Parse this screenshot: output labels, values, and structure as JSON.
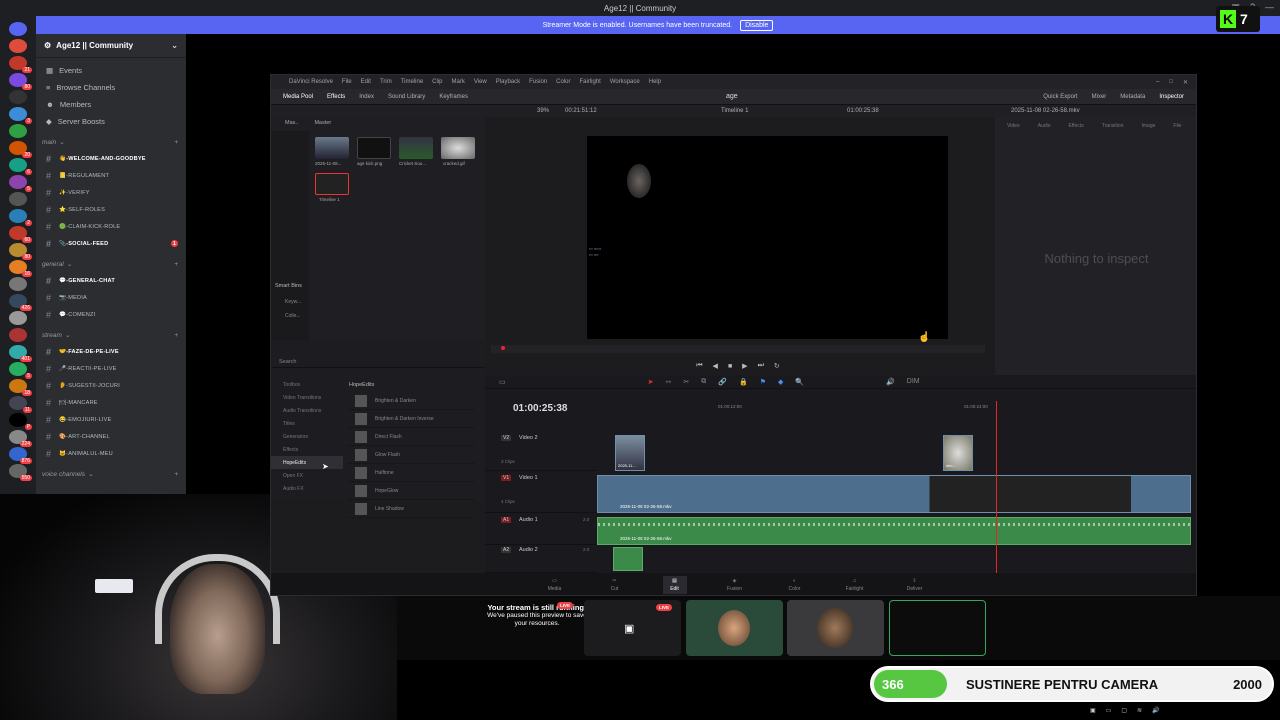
{
  "window": {
    "title": "Age12 || Community"
  },
  "banner": {
    "text": "Streamer Mode is enabled. Usernames have been truncated.",
    "button": "Disable"
  },
  "kick": {
    "count": "7"
  },
  "servers": [
    {
      "badge": ""
    },
    {
      "badge": "21"
    },
    {
      "badge": "80"
    },
    {
      "badge": ""
    },
    {
      "badge": "3"
    },
    {
      "badge": ""
    },
    {
      "badge": "20"
    },
    {
      "badge": "6"
    },
    {
      "badge": "5"
    },
    {
      "badge": ""
    },
    {
      "badge": "2"
    },
    {
      "badge": "60"
    },
    {
      "badge": "80"
    },
    {
      "badge": "16"
    },
    {
      "badge": ""
    },
    {
      "badge": "426"
    },
    {
      "badge": ""
    },
    {
      "badge": ""
    },
    {
      "badge": "401"
    },
    {
      "badge": "5"
    },
    {
      "badge": "18"
    },
    {
      "badge": "11"
    },
    {
      "badge": "P"
    },
    {
      "badge": "224"
    },
    {
      "badge": "876"
    },
    {
      "badge": "550"
    }
  ],
  "guild": {
    "name": "Age12 || Community"
  },
  "nav": {
    "events": "Events",
    "browse": "Browse Channels",
    "members": "Members",
    "boosts": "Server Boosts"
  },
  "categories": {
    "main": "main",
    "general": "general",
    "stream": "stream",
    "voice": "voice channels"
  },
  "channels_main": [
    {
      "label": "👋-welcome-and-goodbye"
    },
    {
      "label": "📒-regulament"
    },
    {
      "label": "✨-verify"
    },
    {
      "label": "⭐-self-roles"
    },
    {
      "label": "🟢-claim-kick-role"
    },
    {
      "label": "📎-social-feed",
      "badge": "1"
    }
  ],
  "channels_general": [
    {
      "label": "💬-general-chat"
    },
    {
      "label": "📷-media"
    },
    {
      "label": "💬-comenzi"
    }
  ],
  "channels_stream": [
    {
      "label": "🤝-faze-de-pe-live"
    },
    {
      "label": "🎤-reactii-pe-live"
    },
    {
      "label": "👂-sugestii-jocuri"
    },
    {
      "label": "🍽-mancare"
    },
    {
      "label": "😂-emojiuri-live"
    },
    {
      "label": "🎨-art-channel"
    },
    {
      "label": "🐱-animalul-meu"
    }
  ],
  "davinci": {
    "menu": [
      "DaVinci Resolve",
      "File",
      "Edit",
      "Trim",
      "Timeline",
      "Clip",
      "Mark",
      "View",
      "Playback",
      "Fusion",
      "Color",
      "Fairlight",
      "Workspace",
      "Help"
    ],
    "toolbar_left": [
      "Media Pool",
      "Effects",
      "Index",
      "Sound Library",
      "Keyframes"
    ],
    "project": "age",
    "toolbar_right": [
      "Quick Export",
      "Mixer",
      "Metadata",
      "Inspector"
    ],
    "zoom": "39%",
    "viewer_timecode": "00:21:51:12",
    "timeline_name": "Timeline 1",
    "timecode_right": "01:00:25:38",
    "inspector_file": "2025-11-08 02-26-58.mkv",
    "mp_tabs": [
      "Mas..",
      "Master"
    ],
    "clips": [
      {
        "label": "2025-11-08..."
      },
      {
        "label": "age kick.png"
      },
      {
        "label": "Cricket Sou..."
      },
      {
        "label": "cracked.gif"
      },
      {
        "label": "Timeline 1"
      }
    ],
    "smart_bins": "Smart Bins",
    "smart_items": [
      "Keyw...",
      "Colle..."
    ],
    "inspector_tabs": [
      "Video",
      "Audio",
      "Effects",
      "Transition",
      "Image",
      "File"
    ],
    "inspector_empty": "Nothing to inspect",
    "fx_search": "Search",
    "fx_tree": [
      "Toolbox",
      "Video Transitions",
      "Audio Transitions",
      "Titles",
      "Generators",
      "Effects",
      "HopeEdits",
      "Open FX",
      "Audio FX"
    ],
    "fx_header": "HopeEdits",
    "fx_items": [
      "Brighten & Darken",
      "Brighten & Darken Inverse",
      "Direct Flash",
      "Glow Flash",
      "Halftone",
      "HopeGlow",
      "Line Shadow"
    ],
    "timeline_tc": "01:00:25:38",
    "ruler": [
      "01:00:12:00",
      "01:00:24:00"
    ],
    "tracks": [
      {
        "tag": "V2",
        "name": "Video 2",
        "clips": "3 Clips"
      },
      {
        "tag": "V1",
        "name": "Video 1",
        "clips": "4 Clips"
      },
      {
        "tag": "A1",
        "name": "Audio 1",
        "clips": "2.0"
      },
      {
        "tag": "A2",
        "name": "Audio 2",
        "clips": "2.0"
      }
    ],
    "v2_clips": [
      "2025-11...",
      "sho..."
    ],
    "v1_clip": "2025-11-08 02-26-58.mkv",
    "a1_clip": "2025-11-08 02-26-58.mkv",
    "dim": "DIM",
    "pages": [
      "Media",
      "Cut",
      "Edit",
      "Fusion",
      "Color",
      "Fairlight",
      "Deliver"
    ]
  },
  "preview": {
    "title": "Your stream is still running!",
    "text": "We've paused this preview to save your resources.",
    "live": "LIVE"
  },
  "goal": {
    "current": "366",
    "label": "SUSTINERE PENTRU CAMERA",
    "target": "2000",
    "progress": 0.183
  },
  "colors": {
    "discord_blurple": "#5865f2",
    "kick_green": "#53fc18",
    "goal_green": "#57c742",
    "live_red": "#ed4245"
  }
}
